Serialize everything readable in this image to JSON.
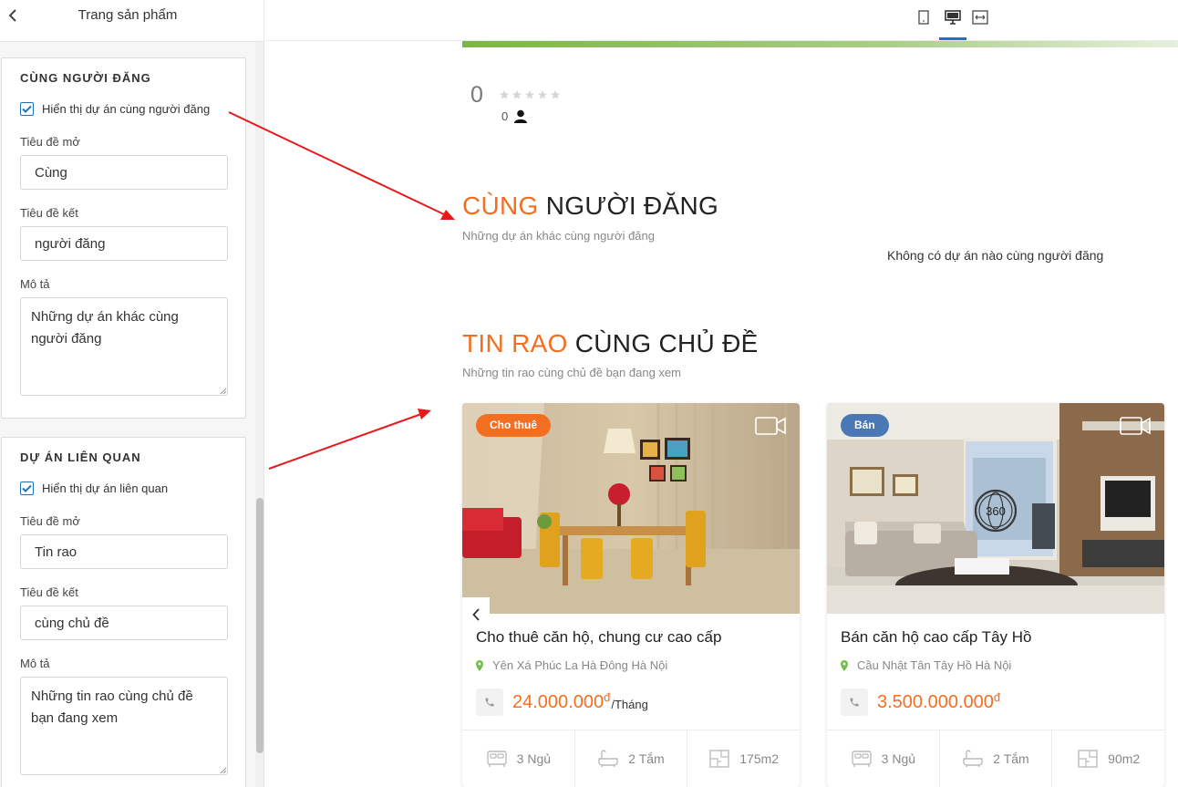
{
  "sidebar": {
    "title": "Trang sản phẩm",
    "panels": [
      {
        "title": "CÙNG NGƯỜI ĐĂNG",
        "checkbox_label": "Hiển thị dự án cùng người đăng",
        "checked": true,
        "open_title_label": "Tiêu đề mở",
        "open_title_value": "Cùng",
        "close_title_label": "Tiêu đề kết",
        "close_title_value": "người đăng",
        "description_label": "Mô tả",
        "description_value": "Những dự án khác cùng người đăng"
      },
      {
        "title": "DỰ ÁN LIÊN QUAN",
        "checkbox_label": "Hiển thị dự án liên quan",
        "checked": true,
        "open_title_label": "Tiêu đề mở",
        "open_title_value": "Tin rao",
        "close_title_label": "Tiêu đề kết",
        "close_title_value": "cùng chủ đề",
        "description_label": "Mô tả",
        "description_value": "Những tin rao cùng chủ đề bạn đang xem"
      }
    ]
  },
  "preview": {
    "device_toolbar": {
      "icons": [
        "mobile-icon",
        "desktop-icon",
        "fullwidth-icon"
      ],
      "active": "desktop-icon"
    },
    "rating": {
      "score": "0",
      "stars": 5,
      "filled_stars": 0,
      "user_count": "0"
    },
    "same_poster": {
      "title_accent": "CÙNG",
      "title_rest": "NGƯỜI ĐĂNG",
      "subtitle": "Những dự án khác cùng người đăng",
      "empty_message": "Không có dự án nào cùng người đăng"
    },
    "related": {
      "title_accent": "TIN RAO",
      "title_rest": "CÙNG CHỦ ĐỀ",
      "subtitle": "Những tin rao cùng chủ đề bạn đang xem",
      "cards": [
        {
          "badge": "Cho thuê",
          "badge_color": "#f26f21",
          "title": "Cho thuê căn hộ, chung cư cao cấp",
          "location": "Yên Xá Phúc La Hà Đông Hà Nội",
          "price": "24.000.000",
          "currency": "đ",
          "price_unit": "/Tháng",
          "bedrooms": "3 Ngủ",
          "bathrooms": "2 Tắm",
          "area": "175m2"
        },
        {
          "badge": "Bán",
          "badge_color": "#4a78b5",
          "title": "Bán căn hộ cao cấp Tây Hồ",
          "location": "Cầu Nhật Tân Tây Hồ Hà Nội",
          "price": "3.500.000.000",
          "currency": "đ",
          "price_unit": "",
          "bedrooms": "3 Ngủ",
          "bathrooms": "2 Tắm",
          "area": "90m2",
          "view360_label": "360"
        }
      ]
    }
  },
  "colors": {
    "accent": "#f26f21",
    "primary": "#1e73be",
    "arrow": "#e8191b"
  }
}
